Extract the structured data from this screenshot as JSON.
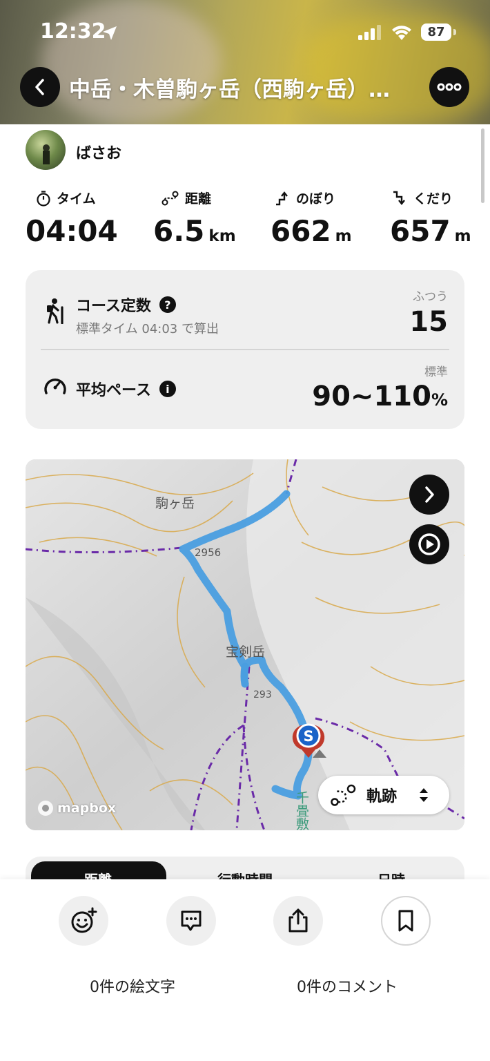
{
  "status_bar": {
    "time": "12:32",
    "battery": "87"
  },
  "header": {
    "title": "中岳・木曽駒ヶ岳（西駒ヶ岳）…"
  },
  "user": {
    "name": "ばさお"
  },
  "stats": [
    {
      "label": "タイム",
      "value": "04:04",
      "unit": ""
    },
    {
      "label": "距離",
      "value": "6.5",
      "unit": "km"
    },
    {
      "label": "のぼり",
      "value": "662",
      "unit": "m"
    },
    {
      "label": "くだり",
      "value": "657",
      "unit": "m"
    }
  ],
  "course": {
    "title": "コース定数",
    "sub": "標準タイム 04:03 で算出",
    "level": "ふつう",
    "value": "15"
  },
  "pace": {
    "title": "平均ペース",
    "level": "標準",
    "value": "90~110",
    "unit": "%"
  },
  "map": {
    "labels": {
      "peak1": "駒ヶ岳",
      "elev1": "2956",
      "peak2": "宝剣岳",
      "elev2": "293",
      "place": "千畳敷"
    },
    "start_marker": "S",
    "track_label": "軌跡",
    "attribution": "mapbox",
    "route_color": "#4a9ee0"
  },
  "tabs": {
    "items": [
      "距離",
      "行動時間",
      "日時"
    ],
    "active": "距離"
  },
  "actions": {
    "emoji_count": "0件の絵文字",
    "comment_count": "0件のコメント"
  }
}
